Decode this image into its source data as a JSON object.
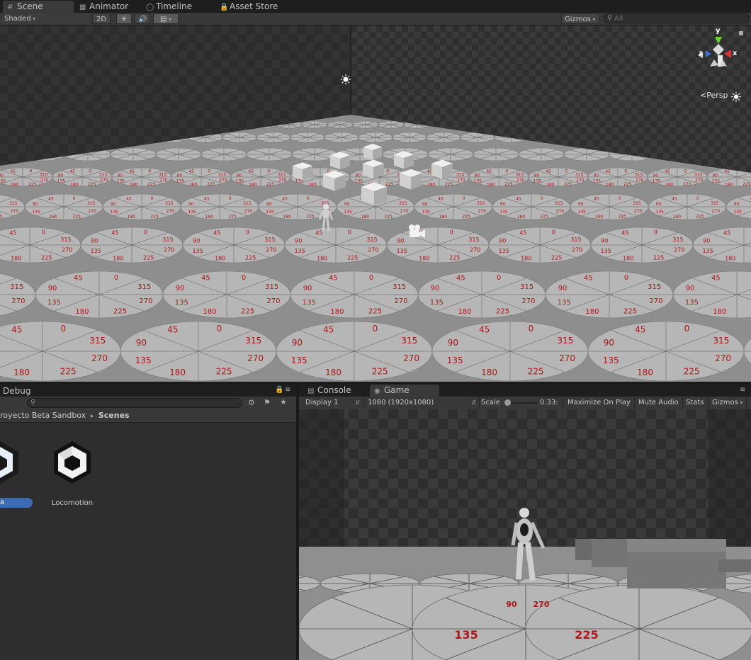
{
  "tabs": [
    {
      "label": "Scene",
      "icon": "grid-icon",
      "active": true
    },
    {
      "label": "Animator",
      "icon": "animator-icon",
      "active": false
    },
    {
      "label": "Timeline",
      "icon": "timeline-icon",
      "active": false
    },
    {
      "label": "Asset Store",
      "icon": "store-icon",
      "active": false
    }
  ],
  "scene_toolbar": {
    "shading_mode": "Shaded",
    "mode_2d": "2D",
    "gizmos": "Gizmos",
    "search_placeholder": "All"
  },
  "scene_view": {
    "gizmo_axes": {
      "y": "y",
      "z": "z",
      "x": "x"
    },
    "projection": "Persp",
    "protractor_labels": [
      "270",
      "225",
      "180",
      "135",
      "90",
      "45",
      "0",
      "315"
    ]
  },
  "project_panel": {
    "tab_label": "Debug",
    "breadcrumb": {
      "parent": "royecto Beta Sandbox",
      "separator": "▸",
      "current": "Scenes"
    },
    "assets": [
      {
        "name": "a",
        "selected": true,
        "icon": "unity-scene-icon"
      },
      {
        "name": "Locomotion",
        "selected": false,
        "icon": "unity-scene-icon"
      }
    ]
  },
  "bottom_tabs": [
    {
      "label": "Console",
      "icon": "console-icon",
      "active": false
    },
    {
      "label": "Game",
      "icon": "game-icon",
      "active": true
    }
  ],
  "game_toolbar": {
    "display": "Display 1",
    "resolution": "1080 (1920x1080)",
    "scale_label": "Scale",
    "scale_value": "0.33:",
    "scale_level": 0.05,
    "maximize_on_play": "Maximize On Play",
    "mute_audio": "Mute Audio",
    "stats": "Stats",
    "gizmos": "Gizmos"
  },
  "game_view": {
    "floor_labels": [
      "90",
      "270",
      "135",
      "225"
    ]
  },
  "colors": {
    "panel_bg": "#383838",
    "tab_bar": "#1e1e1e",
    "selected_asset": "#3d6bb3",
    "floor": "#9a9a9a",
    "disc": "#b6b6b6",
    "angle_label": "#b01515"
  }
}
